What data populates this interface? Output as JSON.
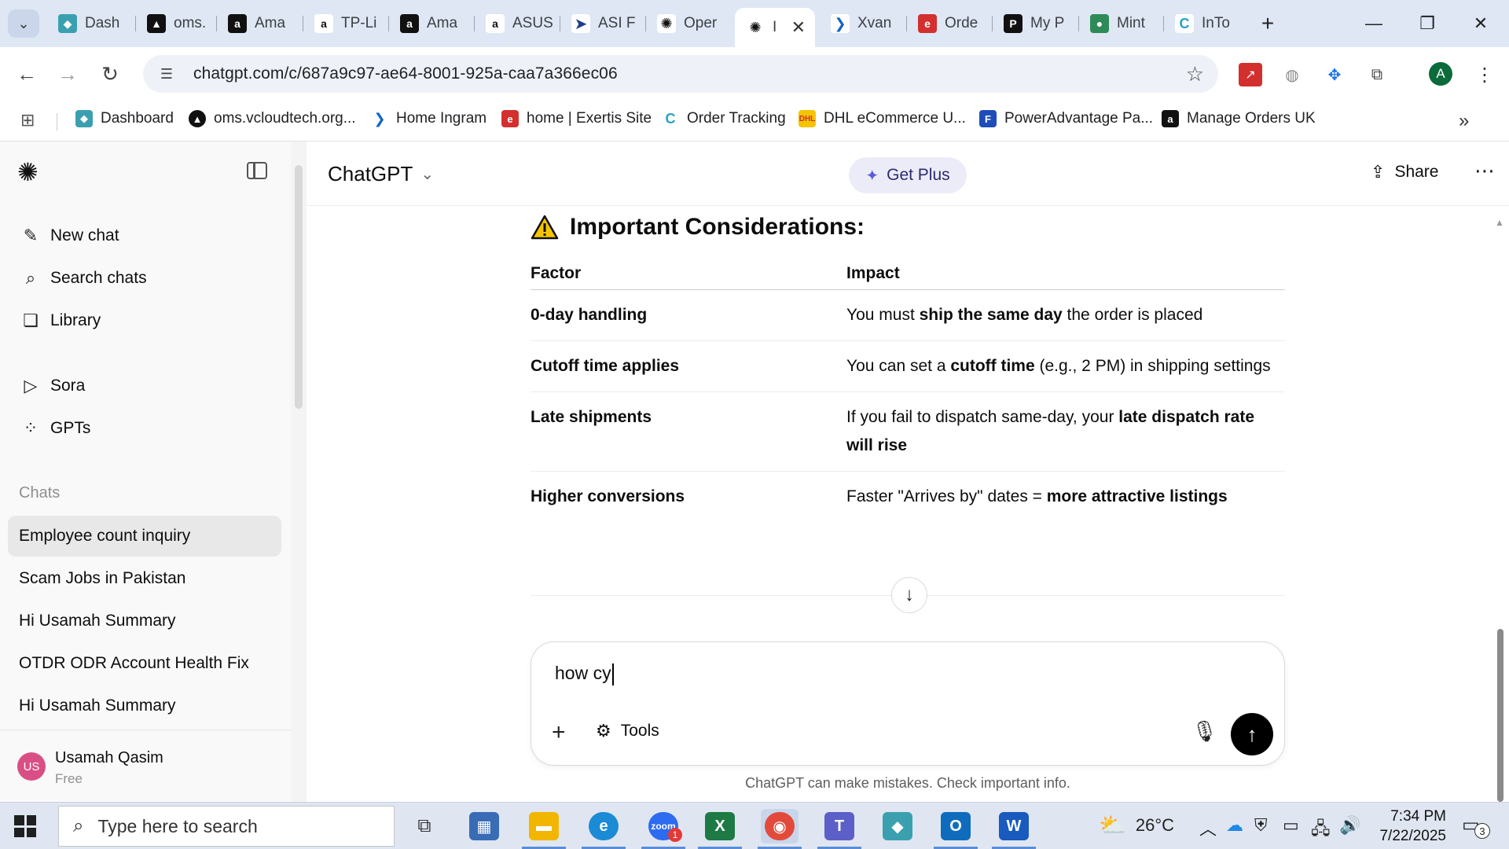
{
  "browser": {
    "tabs": [
      {
        "label": "Dash",
        "icon": "dashboard-favicon",
        "color": "#3aa0b0"
      },
      {
        "label": "oms.",
        "icon": "oms-favicon",
        "color": "#111111"
      },
      {
        "label": "Ama",
        "icon": "amazon-favicon",
        "color": "#111111"
      },
      {
        "label": "TP-Li",
        "icon": "amazon-favicon",
        "color": "#ffffff"
      },
      {
        "label": "Ama",
        "icon": "amazon-favicon",
        "color": "#111111"
      },
      {
        "label": "ASUS",
        "icon": "amazon-favicon",
        "color": "#ffffff"
      },
      {
        "label": "ASI F",
        "icon": "asi-favicon",
        "color": "#1f3b8f"
      },
      {
        "label": "Oper",
        "icon": "openai-favicon",
        "color": "#ffffff"
      },
      {
        "label": "I",
        "icon": "openai-favicon",
        "color": "#ffffff"
      },
      {
        "label": "Xvan",
        "icon": "ingram-favicon",
        "color": "#1565c0"
      },
      {
        "label": "Orde",
        "icon": "exertis-favicon",
        "color": "#d32f2f"
      },
      {
        "label": "My P",
        "icon": "myp-favicon",
        "color": "#111111"
      },
      {
        "label": "Mint",
        "icon": "mint-favicon",
        "color": "#2e8b57"
      },
      {
        "label": "InTo",
        "icon": "intouch-favicon",
        "color": "#26a3c4"
      }
    ],
    "url": "chatgpt.com/c/687a9c97-ae64-8001-925a-caa7a366ec06",
    "profile_initial": "A",
    "bookmarks": [
      {
        "label": "Dashboard",
        "color": "#3aa0b0"
      },
      {
        "label": "oms.vcloudtech.org...",
        "color": "#111111"
      },
      {
        "label": "Home Ingram",
        "color": "#1565c0"
      },
      {
        "label": "home | Exertis Site",
        "color": "#d32f2f"
      },
      {
        "label": "Order Tracking",
        "color": "#26a3c4"
      },
      {
        "label": "DHL eCommerce U...",
        "color": "#f5c400"
      },
      {
        "label": "PowerAdvantage Pa...",
        "color": "#1e4db7"
      },
      {
        "label": "Manage Orders UK",
        "color": "#111111"
      }
    ]
  },
  "sidebar": {
    "nav": [
      {
        "label": "New chat",
        "icon": "edit-icon"
      },
      {
        "label": "Search chats",
        "icon": "search-icon"
      },
      {
        "label": "Library",
        "icon": "library-icon"
      },
      {
        "label": "Sora",
        "icon": "play-icon"
      },
      {
        "label": "GPTs",
        "icon": "grid-icon"
      }
    ],
    "section_label": "Chats",
    "chats": [
      "Employee count inquiry",
      "Scam Jobs in Pakistan",
      "Hi Usamah Summary",
      "OTDR ODR Account Health Fix",
      "Hi Usamah Summary"
    ],
    "user": {
      "initials": "US",
      "name": "Usamah Qasim",
      "plan": "Free"
    }
  },
  "header": {
    "title": "ChatGPT",
    "get_plus": "Get Plus",
    "share": "Share"
  },
  "message": {
    "heading": "Important Considerations:",
    "table": {
      "headers": [
        "Factor",
        "Impact"
      ],
      "rows": [
        {
          "factor": "0-day handling",
          "pre": "You must ",
          "bold": "ship the same day",
          "post": " the order is placed"
        },
        {
          "factor": "Cutoff time applies",
          "pre": "You can set a ",
          "bold": "cutoff time",
          "post": " (e.g., 2 PM) in shipping settings"
        },
        {
          "factor": "Late shipments",
          "pre": "If you fail to dispatch same-day, your ",
          "bold": "late dispatch rate will rise",
          "post": ""
        },
        {
          "factor": "Higher conversions",
          "pre": "Faster \"Arrives by\" dates = ",
          "bold": "more attractive listings",
          "post": ""
        }
      ]
    }
  },
  "composer": {
    "value": "how cy",
    "tools_label": "Tools"
  },
  "disclaimer": "ChatGPT can make mistakes. Check important info.",
  "taskbar": {
    "search_placeholder": "Type here to search",
    "weather": "26°C",
    "time": "7:34 PM",
    "date": "7/22/2025",
    "notifications": "3",
    "zoom_badge": "1"
  }
}
